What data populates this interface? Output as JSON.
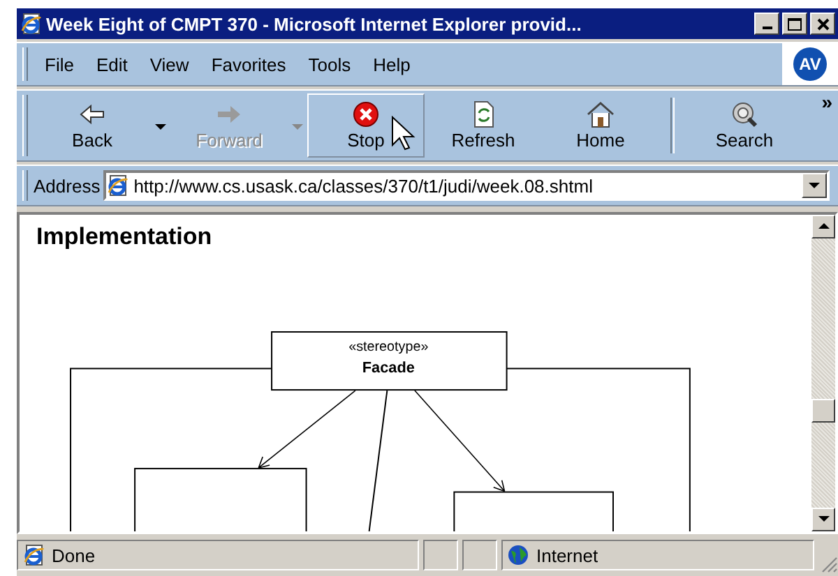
{
  "window": {
    "title": "Week Eight of CMPT 370 - Microsoft Internet Explorer provid..."
  },
  "menu": [
    "File",
    "Edit",
    "View",
    "Favorites",
    "Tools",
    "Help"
  ],
  "logo": "AV",
  "toolbar": [
    {
      "kind": "back",
      "label": "Back",
      "disabled": false,
      "hovered": false,
      "dropdown": true
    },
    {
      "kind": "forward",
      "label": "Forward",
      "disabled": true,
      "hovered": false,
      "dropdown": true
    },
    {
      "kind": "stop",
      "label": "Stop",
      "disabled": false,
      "hovered": true,
      "dropdown": false
    },
    {
      "kind": "refresh",
      "label": "Refresh",
      "disabled": false,
      "hovered": false,
      "dropdown": false
    },
    {
      "kind": "home",
      "label": "Home",
      "disabled": false,
      "hovered": false,
      "dropdown": false
    },
    {
      "kind": "separator"
    },
    {
      "kind": "search",
      "label": "Search",
      "disabled": false,
      "hovered": false,
      "dropdown": false
    }
  ],
  "toolbar_more": "»",
  "address": {
    "label": "Address",
    "value": "http://www.cs.usask.ca/classes/370/t1/judi/week.08.shtml"
  },
  "page": {
    "heading": "Implementation",
    "diagram": {
      "stereotype": "«stereotype»",
      "name": "Facade"
    }
  },
  "status_bar": {
    "text": "Done",
    "zone": "Internet"
  }
}
